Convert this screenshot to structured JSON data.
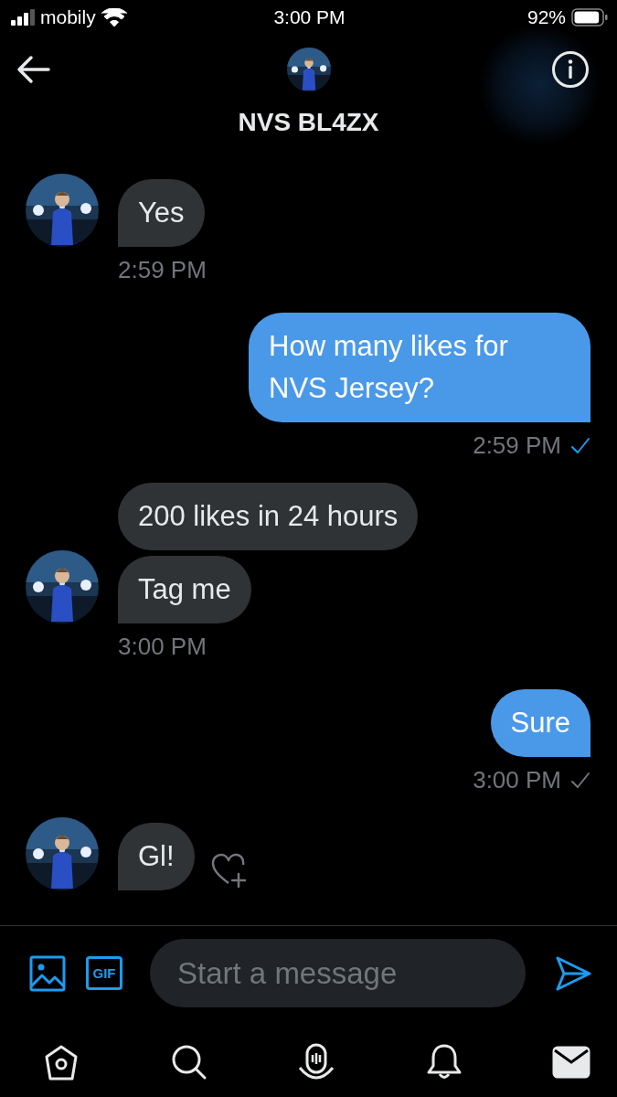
{
  "status_bar": {
    "carrier": "mobily",
    "time": "3:00 PM",
    "battery": "92%"
  },
  "header": {
    "title": "NVS BL4ZX"
  },
  "groups": [
    {
      "kind": "received",
      "messages": [
        "Yes"
      ],
      "time": "2:59 PM"
    },
    {
      "kind": "sent",
      "messages": [
        "How many likes for NVS Jersey?"
      ],
      "time": "2:59 PM",
      "seen": true
    },
    {
      "kind": "received",
      "messages": [
        "200 likes in 24 hours",
        "Tag me"
      ],
      "time": "3:00 PM"
    },
    {
      "kind": "sent",
      "messages": [
        "Sure"
      ],
      "time": "3:00 PM",
      "seen": false
    },
    {
      "kind": "received",
      "messages": [
        "Gl!"
      ],
      "react": true
    }
  ],
  "composer": {
    "placeholder": "Start a message",
    "gif": "GIF"
  },
  "tabs": [
    {
      "kind": "home",
      "selected": false
    },
    {
      "kind": "search",
      "selected": false
    },
    {
      "kind": "spaces",
      "selected": false
    },
    {
      "kind": "notifications",
      "selected": false
    },
    {
      "kind": "messages",
      "selected": true
    }
  ]
}
